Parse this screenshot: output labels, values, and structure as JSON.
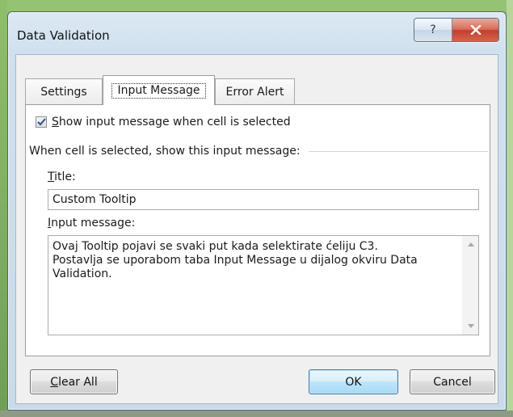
{
  "window": {
    "title": "Data Validation",
    "help_label": "?",
    "close_icon": "close-icon"
  },
  "tabs": [
    {
      "label": "Settings",
      "active": false
    },
    {
      "label": "Input Message",
      "active": true
    },
    {
      "label": "Error Alert",
      "active": false
    }
  ],
  "input_message": {
    "show_checkbox_checked": true,
    "show_checkbox_label_accel": "S",
    "show_checkbox_label_rest": "how input message when cell is selected",
    "group_label": "When cell is selected, show this input message:",
    "title_label_accel": "T",
    "title_label_rest": "itle:",
    "title_value": "Custom Tooltip",
    "message_label_accel": "I",
    "message_label_rest": "nput message:",
    "message_value": "Ovaj Tooltip pojavi se svaki put kada selektirate ćeliju C3.\nPostavlja se uporabom taba Input Message u dijalog okviru Data Validation."
  },
  "buttons": {
    "clear_all_accel": "C",
    "clear_all_rest": "lear All",
    "ok": "OK",
    "cancel": "Cancel"
  },
  "colors": {
    "accent": "#3c7fb1",
    "close_red": "#c23f2b"
  }
}
